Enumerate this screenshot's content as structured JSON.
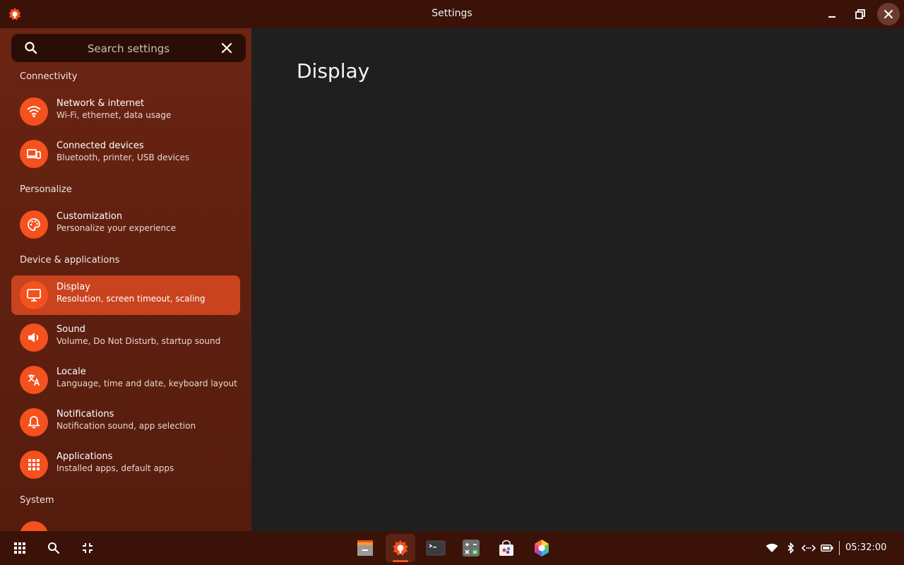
{
  "window": {
    "title": "Settings"
  },
  "search": {
    "placeholder": "Search settings"
  },
  "sidebar": {
    "sections": {
      "connectivity": "Connectivity",
      "personalize": "Personalize",
      "device": "Device & applications",
      "system": "System"
    },
    "items": [
      {
        "label": "Network & internet",
        "desc": "Wi-Fi, ethernet, data usage",
        "icon": "wifi-icon"
      },
      {
        "label": "Connected devices",
        "desc": "Bluetooth, printer, USB devices",
        "icon": "devices-icon"
      },
      {
        "label": "Customization",
        "desc": "Personalize your experience",
        "icon": "palette-icon"
      },
      {
        "label": "Display",
        "desc": "Resolution, screen timeout, scaling",
        "icon": "monitor-icon",
        "selected": true
      },
      {
        "label": "Sound",
        "desc": "Volume, Do Not Disturb, startup sound",
        "icon": "speaker-icon"
      },
      {
        "label": "Locale",
        "desc": "Language, time and date, keyboard layout",
        "icon": "translate-icon"
      },
      {
        "label": "Notifications",
        "desc": "Notification sound, app selection",
        "icon": "bell-icon"
      },
      {
        "label": "Applications",
        "desc": "Installed apps, default apps",
        "icon": "apps-grid-icon"
      }
    ]
  },
  "main": {
    "heading": "Display"
  },
  "taskbar": {
    "clock": "05:32:00"
  },
  "colors": {
    "accent": "#f4511e",
    "titlebar": "#3a1208",
    "sidebar": "#6b2412",
    "content": "#1f1f1f"
  }
}
